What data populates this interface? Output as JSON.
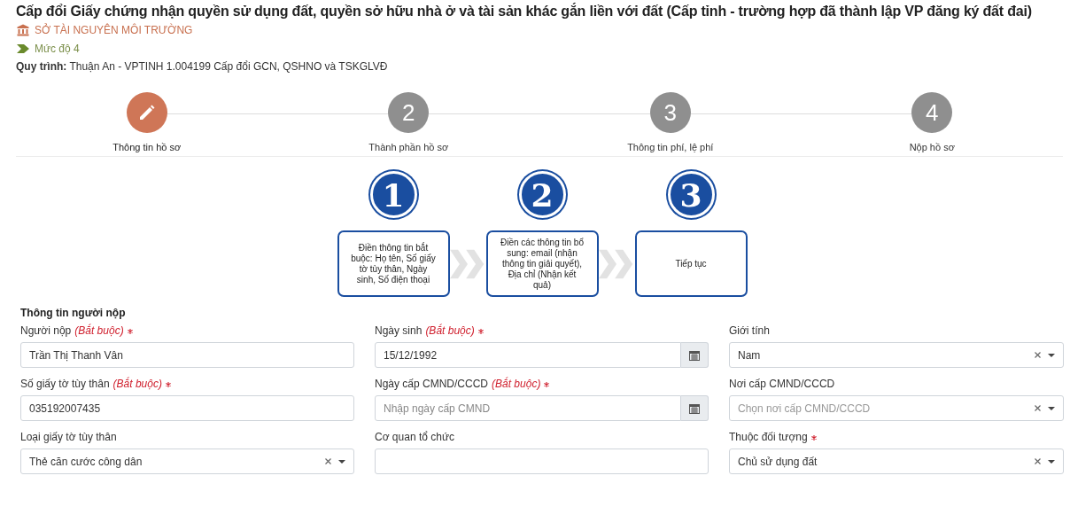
{
  "header": {
    "title": "Cấp đổi Giấy chứng nhận quyền sử dụng đất, quyền sở hữu nhà ở và tài sản khác gắn liền với đất (Cấp tỉnh - trường hợp đã thành lập VP đăng ký đất đai)",
    "agency": "SỞ TÀI NGUYÊN MÔI TRƯỜNG",
    "level": "Mức độ 4",
    "process_label": "Quy trình:",
    "process": "Thuận An - VPTINH 1.004199 Cấp đổi GCN, QSHNO và TSKGLVĐ"
  },
  "stepper": [
    {
      "label": "Thông tin hồ sơ",
      "selected": true
    },
    {
      "number": "2",
      "label": "Thành phần hồ sơ",
      "selected": false
    },
    {
      "number": "3",
      "label": "Thông tin phí, lệ phí",
      "selected": false
    },
    {
      "number": "4",
      "label": "Nộp hồ sơ",
      "selected": false
    }
  ],
  "guide": [
    {
      "number": "1",
      "text": "Điền thông tin bắt buộc: Họ tên, Số giấy tờ tùy thân, Ngày sinh, Số điện thoại"
    },
    {
      "number": "2",
      "text": "Điền các thông tin bổ sung: email (nhận thông tin giải quyết), Địa chỉ (Nhận kết quả)"
    },
    {
      "number": "3",
      "text": "Tiếp tục"
    }
  ],
  "form": {
    "section_title": "Thông tin người nộp",
    "fields": [
      {
        "kind": "text",
        "label": "Người nộp",
        "hint": "(Bắt buộc)",
        "required": true,
        "value": "Trần Thị Thanh Vân"
      },
      {
        "kind": "date",
        "label": "Ngày sinh",
        "hint": "(Bắt buộc)",
        "required": true,
        "value": "15/12/1992"
      },
      {
        "kind": "select",
        "label": "Giới tính",
        "required": false,
        "value": "Nam"
      },
      {
        "kind": "text",
        "label": "Số giấy tờ tùy thân",
        "hint": "(Bắt buộc)",
        "required": true,
        "value": "035192007435"
      },
      {
        "kind": "date",
        "label": "Ngày cấp CMND/CCCD",
        "hint": "(Bắt buộc)",
        "required": true,
        "placeholder": "Nhập ngày cấp CMND"
      },
      {
        "kind": "select",
        "label": "Nơi cấp CMND/CCCD",
        "required": false,
        "placeholder": "Chọn nơi cấp CMND/CCCD"
      },
      {
        "kind": "select",
        "label": "Loại giấy tờ tùy thân",
        "required": false,
        "value": "Thẻ căn cước công dân"
      },
      {
        "kind": "text",
        "label": "Cơ quan tổ chức",
        "required": false
      },
      {
        "kind": "select",
        "label": "Thuộc đối tượng",
        "required": true,
        "value": "Chủ sử dụng đất"
      }
    ]
  }
}
